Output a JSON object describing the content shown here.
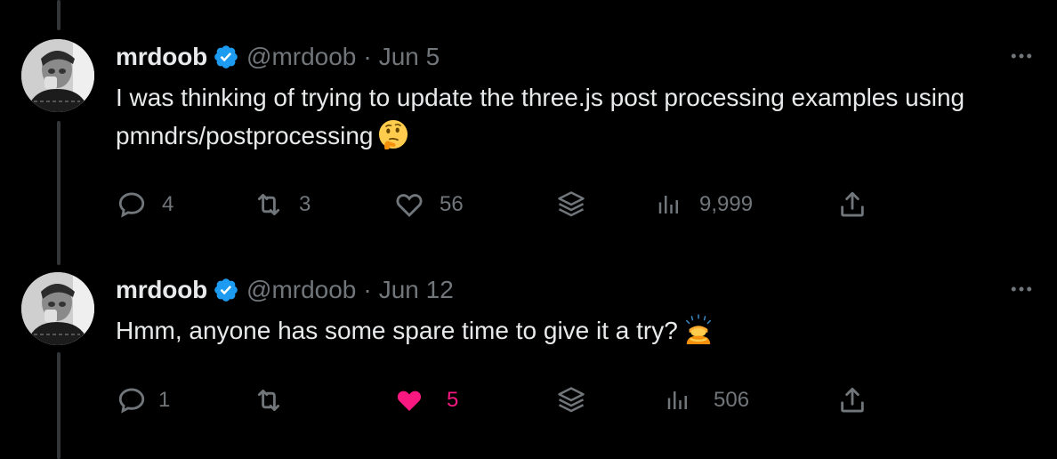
{
  "colors": {
    "background": "#000000",
    "text_primary": "#e7e9ea",
    "text_secondary": "#71767b",
    "verified_blue": "#1d9bf0",
    "like_pink": "#f91880",
    "thread_line": "#333639"
  },
  "tweets": [
    {
      "name": "mrdoob",
      "handle": "@mrdoob",
      "separator": "·",
      "date": "Jun 5",
      "text": "I was thinking of trying to update the three.js post processing examples using pmndrs/postprocessing",
      "emoji": "thinking-face",
      "actions": {
        "replies": "4",
        "retweets": "3",
        "likes": "56",
        "bookmarks": "",
        "views": "9,999"
      },
      "liked": false
    },
    {
      "name": "mrdoob",
      "handle": "@mrdoob",
      "separator": "·",
      "date": "Jun 12",
      "text": "Hmm, anyone has some spare time to give it a try?",
      "emoji": "person-bowing",
      "actions": {
        "replies": "1",
        "retweets": "",
        "likes": "5",
        "bookmarks": "",
        "views": "506"
      },
      "liked": true
    }
  ]
}
